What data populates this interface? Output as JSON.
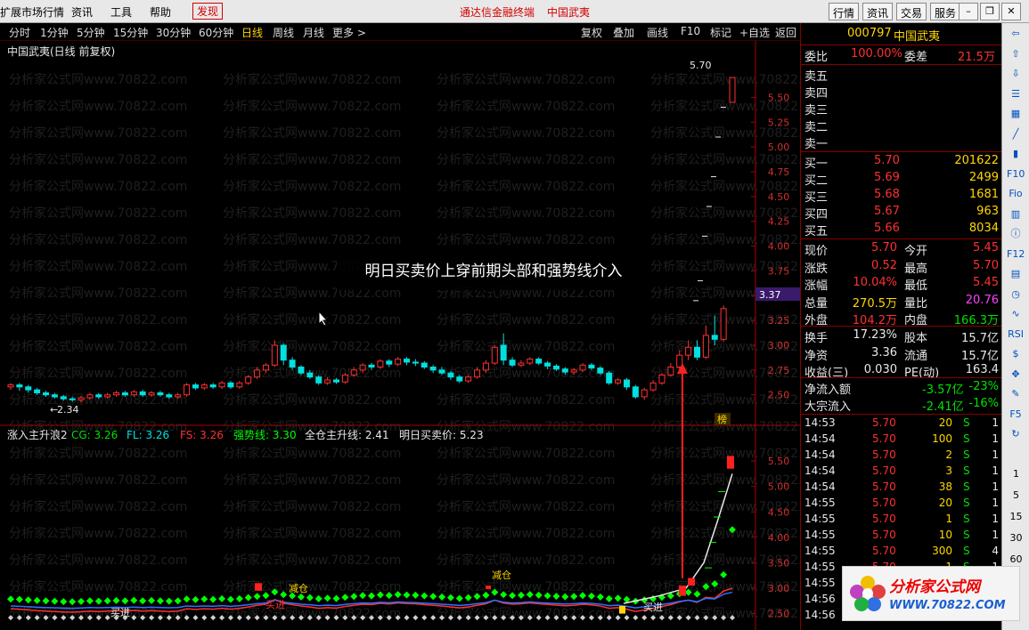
{
  "menubar": {
    "items": [
      "扩展市场行情",
      "资讯",
      "工具",
      "帮助"
    ],
    "discover": "发现",
    "center_title": "通达信金融终端",
    "center_stock": "中国武夷",
    "right_buttons": [
      "行情",
      "资讯",
      "交易",
      "服务"
    ]
  },
  "toolbar": {
    "periods": [
      "分时",
      "1分钟",
      "5分钟",
      "15分钟",
      "30分钟",
      "60分钟",
      "日线",
      "周线",
      "月线",
      "更多 >"
    ],
    "active_period": "日线",
    "buttons": [
      "复权",
      "叠加",
      "画线",
      "F10",
      "标记",
      "+自选",
      "返回"
    ]
  },
  "main_chart": {
    "title": "中国武夷(日线 前复权)",
    "high_label": "5.70",
    "low_label": "2.34",
    "current_price_tag": "3.37",
    "badge": "榜",
    "y_ticks": [
      "5.50",
      "5.25",
      "5.00",
      "4.75",
      "4.50",
      "4.25",
      "4.00",
      "3.75",
      "3.50",
      "3.25",
      "3.00",
      "2.75",
      "2.50"
    ],
    "watermark": "分析家公式网www.70822.com"
  },
  "overlay_note": "明日买卖价上穿前期头部和强势线介入",
  "indicator": {
    "name": "涨入主升浪2",
    "values": [
      {
        "label": "CG: 3.26",
        "color": "#00e000"
      },
      {
        "label": "FL: 3.26",
        "color": "#00e0e0"
      },
      {
        "label": "FS: 3.26",
        "color": "#ff3030"
      },
      {
        "label": "强势线: 3.30",
        "color": "#00ff00"
      },
      {
        "label": "全仓主升线: 2.41",
        "color": "#e8e8e8"
      },
      {
        "label": "明日买卖价: 5.23",
        "color": "#e8e8e8"
      }
    ],
    "y_ticks": [
      "5.50",
      "5.00",
      "4.50",
      "4.00",
      "3.50",
      "3.00",
      "2.50"
    ],
    "annotations": [
      "减仓",
      "减仓",
      "买进",
      "买进",
      "买进"
    ]
  },
  "chart_data": {
    "type": "candlestick",
    "title": "中国武夷(日线 前复权)",
    "ylim": [
      2.3,
      5.8
    ],
    "candles": [
      [
        2.58,
        2.6,
        2.55,
        2.62
      ],
      [
        2.6,
        2.58,
        2.54,
        2.62
      ],
      [
        2.58,
        2.55,
        2.52,
        2.6
      ],
      [
        2.55,
        2.52,
        2.5,
        2.57
      ],
      [
        2.52,
        2.5,
        2.48,
        2.54
      ],
      [
        2.5,
        2.48,
        2.46,
        2.52
      ],
      [
        2.48,
        2.46,
        2.44,
        2.5
      ],
      [
        2.46,
        2.45,
        2.43,
        2.48
      ],
      [
        2.45,
        2.47,
        2.42,
        2.49
      ],
      [
        2.47,
        2.5,
        2.45,
        2.52
      ],
      [
        2.5,
        2.48,
        2.46,
        2.52
      ],
      [
        2.48,
        2.5,
        2.46,
        2.52
      ],
      [
        2.5,
        2.52,
        2.48,
        2.54
      ],
      [
        2.52,
        2.5,
        2.48,
        2.54
      ],
      [
        2.5,
        2.53,
        2.48,
        2.55
      ],
      [
        2.53,
        2.5,
        2.48,
        2.55
      ],
      [
        2.5,
        2.52,
        2.48,
        2.54
      ],
      [
        2.52,
        2.5,
        2.48,
        2.54
      ],
      [
        2.5,
        2.48,
        2.46,
        2.52
      ],
      [
        2.48,
        2.5,
        2.46,
        2.52
      ],
      [
        2.5,
        2.6,
        2.48,
        2.62
      ],
      [
        2.6,
        2.57,
        2.55,
        2.62
      ],
      [
        2.57,
        2.6,
        2.55,
        2.62
      ],
      [
        2.6,
        2.58,
        2.56,
        2.62
      ],
      [
        2.58,
        2.62,
        2.56,
        2.64
      ],
      [
        2.62,
        2.58,
        2.56,
        2.64
      ],
      [
        2.58,
        2.62,
        2.56,
        2.64
      ],
      [
        2.62,
        2.68,
        2.6,
        2.7
      ],
      [
        2.68,
        2.75,
        2.66,
        2.78
      ],
      [
        2.75,
        2.8,
        2.72,
        2.82
      ],
      [
        2.8,
        3.0,
        2.78,
        3.05
      ],
      [
        3.0,
        2.85,
        2.8,
        3.02
      ],
      [
        2.85,
        2.78,
        2.75,
        2.88
      ],
      [
        2.78,
        2.72,
        2.7,
        2.8
      ],
      [
        2.72,
        2.68,
        2.66,
        2.75
      ],
      [
        2.68,
        2.62,
        2.6,
        2.7
      ],
      [
        2.62,
        2.65,
        2.6,
        2.68
      ],
      [
        2.65,
        2.63,
        2.61,
        2.67
      ],
      [
        2.63,
        2.7,
        2.61,
        2.72
      ],
      [
        2.7,
        2.75,
        2.68,
        2.78
      ],
      [
        2.75,
        2.8,
        2.72,
        2.82
      ],
      [
        2.8,
        2.78,
        2.75,
        2.82
      ],
      [
        2.78,
        2.84,
        2.76,
        2.86
      ],
      [
        2.84,
        2.81,
        2.78,
        2.86
      ],
      [
        2.81,
        2.86,
        2.79,
        2.88
      ],
      [
        2.86,
        2.83,
        2.8,
        2.88
      ],
      [
        2.83,
        2.82,
        2.79,
        2.86
      ],
      [
        2.82,
        2.78,
        2.76,
        2.84
      ],
      [
        2.78,
        2.75,
        2.72,
        2.8
      ],
      [
        2.75,
        2.72,
        2.7,
        2.78
      ],
      [
        2.72,
        2.68,
        2.65,
        2.74
      ],
      [
        2.68,
        2.64,
        2.62,
        2.7
      ],
      [
        2.64,
        2.68,
        2.62,
        2.7
      ],
      [
        2.68,
        2.75,
        2.66,
        2.78
      ],
      [
        2.75,
        2.82,
        2.72,
        2.85
      ],
      [
        2.82,
        2.98,
        2.8,
        3.0
      ],
      [
        3.0,
        2.85,
        2.8,
        3.12
      ],
      [
        2.85,
        2.8,
        2.78,
        2.88
      ],
      [
        2.8,
        2.82,
        2.78,
        2.85
      ],
      [
        2.82,
        2.86,
        2.8,
        2.88
      ],
      [
        2.86,
        2.82,
        2.8,
        2.88
      ],
      [
        2.82,
        2.79,
        2.76,
        2.84
      ],
      [
        2.79,
        2.76,
        2.74,
        2.81
      ],
      [
        2.76,
        2.73,
        2.7,
        2.78
      ],
      [
        2.73,
        2.75,
        2.7,
        2.77
      ],
      [
        2.75,
        2.8,
        2.73,
        2.82
      ],
      [
        2.8,
        2.77,
        2.75,
        2.82
      ],
      [
        2.77,
        2.72,
        2.7,
        2.79
      ],
      [
        2.72,
        2.62,
        2.6,
        2.74
      ],
      [
        2.62,
        2.65,
        2.6,
        2.67
      ],
      [
        2.65,
        2.58,
        2.55,
        2.67
      ],
      [
        2.58,
        2.48,
        2.46,
        2.6
      ],
      [
        2.48,
        2.55,
        2.45,
        2.57
      ],
      [
        2.55,
        2.62,
        2.53,
        2.65
      ],
      [
        2.62,
        2.7,
        2.6,
        2.72
      ],
      [
        2.7,
        2.78,
        2.68,
        2.82
      ],
      [
        2.78,
        2.9,
        2.76,
        2.95
      ],
      [
        2.9,
        2.98,
        2.85,
        3.05
      ],
      [
        2.98,
        2.88,
        2.85,
        3.05
      ],
      [
        2.88,
        3.1,
        2.86,
        3.2
      ],
      [
        3.1,
        3.06,
        3.0,
        3.3
      ],
      [
        3.06,
        3.37,
        3.04,
        3.4
      ],
      [
        5.45,
        5.7,
        5.45,
        5.7
      ]
    ],
    "series": [
      {
        "name": "强势线",
        "color": "#00ff00"
      },
      {
        "name": "全仓主升线",
        "color": "#e8e8e8"
      },
      {
        "name": "明日买卖价",
        "color": "#e8e8e8"
      }
    ]
  },
  "quote": {
    "code": "000797",
    "name": "中国武夷",
    "weibi_label": "委比",
    "weibi": "100.00%",
    "weicha_label": "委差",
    "weicha": "21.5万",
    "asks": [
      {
        "label": "卖五"
      },
      {
        "label": "卖四"
      },
      {
        "label": "卖三"
      },
      {
        "label": "卖二"
      },
      {
        "label": "卖一"
      }
    ],
    "bids": [
      {
        "label": "买一",
        "price": "5.70",
        "vol": "201622"
      },
      {
        "label": "买二",
        "price": "5.69",
        "vol": "2499"
      },
      {
        "label": "买三",
        "price": "5.68",
        "vol": "1681"
      },
      {
        "label": "买四",
        "price": "5.67",
        "vol": "963"
      },
      {
        "label": "买五",
        "price": "5.66",
        "vol": "8034"
      }
    ],
    "stats": [
      {
        "l1": "现价",
        "v1": "5.70",
        "c1": "red",
        "l2": "今开",
        "v2": "5.45",
        "c2": "red"
      },
      {
        "l1": "涨跌",
        "v1": "0.52",
        "c1": "red",
        "l2": "最高",
        "v2": "5.70",
        "c2": "red"
      },
      {
        "l1": "涨幅",
        "v1": "10.04%",
        "c1": "red",
        "l2": "最低",
        "v2": "5.45",
        "c2": "red"
      },
      {
        "l1": "总量",
        "v1": "270.5万",
        "c1": "yellow",
        "l2": "量比",
        "v2": "20.76",
        "c2": "purple"
      },
      {
        "l1": "外盘",
        "v1": "104.2万",
        "c1": "red",
        "l2": "内盘",
        "v2": "166.3万",
        "c2": "green"
      }
    ],
    "stats2": [
      {
        "l1": "换手",
        "v1": "17.23%",
        "c1": "white",
        "l2": "股本",
        "v2": "15.7亿",
        "c2": "white"
      },
      {
        "l1": "净资",
        "v1": "3.36",
        "c1": "white",
        "l2": "流通",
        "v2": "15.7亿",
        "c2": "white"
      },
      {
        "l1": "收益(三)",
        "v1": "0.030",
        "c1": "white",
        "l2": "PE(动)",
        "v2": "163.4",
        "c2": "white"
      }
    ],
    "flows": [
      {
        "label": "净流入额",
        "value": "-3.57亿",
        "pct": "-23%"
      },
      {
        "label": "大宗流入",
        "value": "-2.41亿",
        "pct": "-16%"
      }
    ],
    "ticks": [
      {
        "time": "14:53",
        "price": "5.70",
        "vol": "20",
        "side": "S",
        "n": "1"
      },
      {
        "time": "14:54",
        "price": "5.70",
        "vol": "100",
        "side": "S",
        "n": "1"
      },
      {
        "time": "14:54",
        "price": "5.70",
        "vol": "2",
        "side": "S",
        "n": "1"
      },
      {
        "time": "14:54",
        "price": "5.70",
        "vol": "3",
        "side": "S",
        "n": "1"
      },
      {
        "time": "14:54",
        "price": "5.70",
        "vol": "38",
        "side": "S",
        "n": "1"
      },
      {
        "time": "14:55",
        "price": "5.70",
        "vol": "20",
        "side": "S",
        "n": "1"
      },
      {
        "time": "14:55",
        "price": "5.70",
        "vol": "1",
        "side": "S",
        "n": "1"
      },
      {
        "time": "14:55",
        "price": "5.70",
        "vol": "10",
        "side": "S",
        "n": "1"
      },
      {
        "time": "14:55",
        "price": "5.70",
        "vol": "300",
        "side": "S",
        "n": "4"
      },
      {
        "time": "14:55",
        "price": "5.70",
        "vol": "1",
        "side": "S",
        "n": "1"
      },
      {
        "time": "14:55",
        "price": "",
        "vol": "",
        "side": "",
        "n": ""
      },
      {
        "time": "14:56",
        "price": "",
        "vol": "",
        "side": "",
        "n": ""
      },
      {
        "time": "14:56",
        "price": "",
        "vol": "",
        "side": "",
        "n": ""
      }
    ]
  },
  "strip": {
    "icons": [
      "left-arrow-icon",
      "up-arrow-icon",
      "down-arrow-icon",
      "list-icon",
      "grid-icon",
      "chart-icon",
      "kline-icon",
      "f10-icon",
      "fio-icon",
      "bar-icon",
      "info-icon",
      "f12-icon",
      "table-icon",
      "clock-icon",
      "wave-icon",
      "rsi-icon",
      "dollar-icon",
      "move-icon",
      "pencil-icon",
      "f5-icon",
      "refresh-icon"
    ],
    "numbers": [
      "1",
      "5",
      "15",
      "30",
      "60"
    ]
  },
  "logo": {
    "title": "分析家公式网",
    "url": "WWW.70822.COM"
  }
}
